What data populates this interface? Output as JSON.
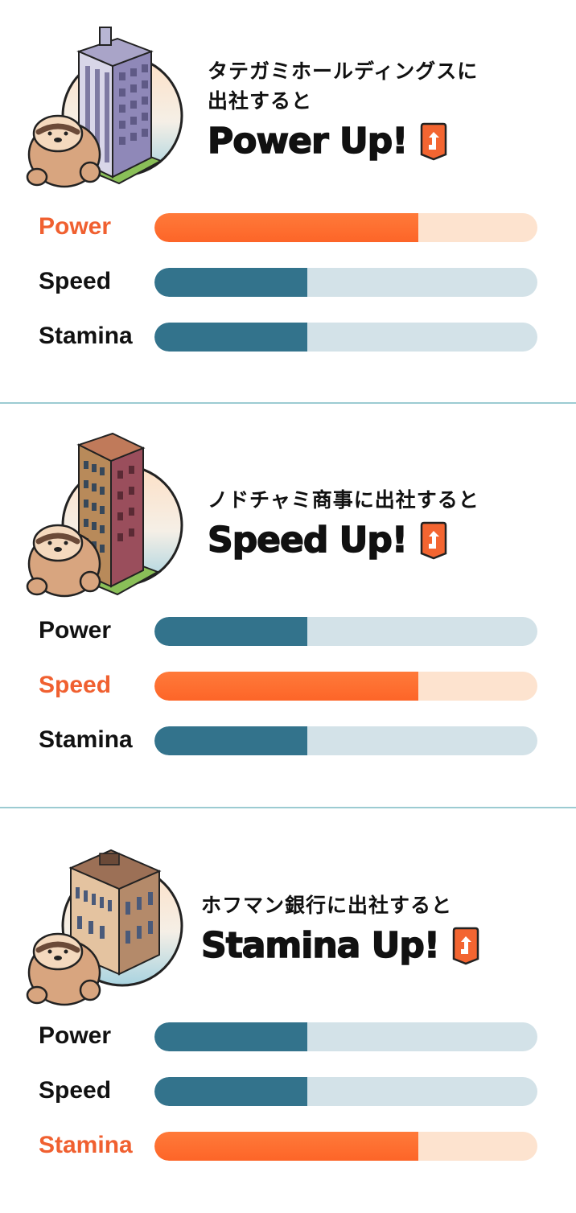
{
  "colors": {
    "accent_orange": "#f06030",
    "bar_blue": "#33738c",
    "bar_blue_track": "#d3e2e8",
    "bar_orange_track": "#fde3cf",
    "divider": "#9ccbd2"
  },
  "sections": [
    {
      "subtitle_line1": "タテガミホールディングスに",
      "subtitle_line2": "出社すると",
      "title": "Power Up!",
      "badge_icon": "up-arrow-badge-icon",
      "illustration": "office-tower-with-sloth-illustration",
      "stats": [
        {
          "label": "Power",
          "value": 0.69,
          "highlighted": true
        },
        {
          "label": "Speed",
          "value": 0.4,
          "highlighted": false
        },
        {
          "label": "Stamina",
          "value": 0.4,
          "highlighted": false
        }
      ]
    },
    {
      "subtitle_line1": "ノドチャミ商事に出社すると",
      "subtitle_line2": "",
      "title": "Speed Up!",
      "badge_icon": "up-arrow-badge-icon",
      "illustration": "brick-building-with-sloth-illustration",
      "stats": [
        {
          "label": "Power",
          "value": 0.4,
          "highlighted": false
        },
        {
          "label": "Speed",
          "value": 0.69,
          "highlighted": true
        },
        {
          "label": "Stamina",
          "value": 0.4,
          "highlighted": false
        }
      ]
    },
    {
      "subtitle_line1": "ホフマン銀行に出社すると",
      "subtitle_line2": "",
      "title": "Stamina Up!",
      "badge_icon": "up-arrow-badge-icon",
      "illustration": "bank-building-with-sloth-illustration",
      "stats": [
        {
          "label": "Power",
          "value": 0.4,
          "highlighted": false
        },
        {
          "label": "Speed",
          "value": 0.4,
          "highlighted": false
        },
        {
          "label": "Stamina",
          "value": 0.69,
          "highlighted": true
        }
      ]
    }
  ]
}
